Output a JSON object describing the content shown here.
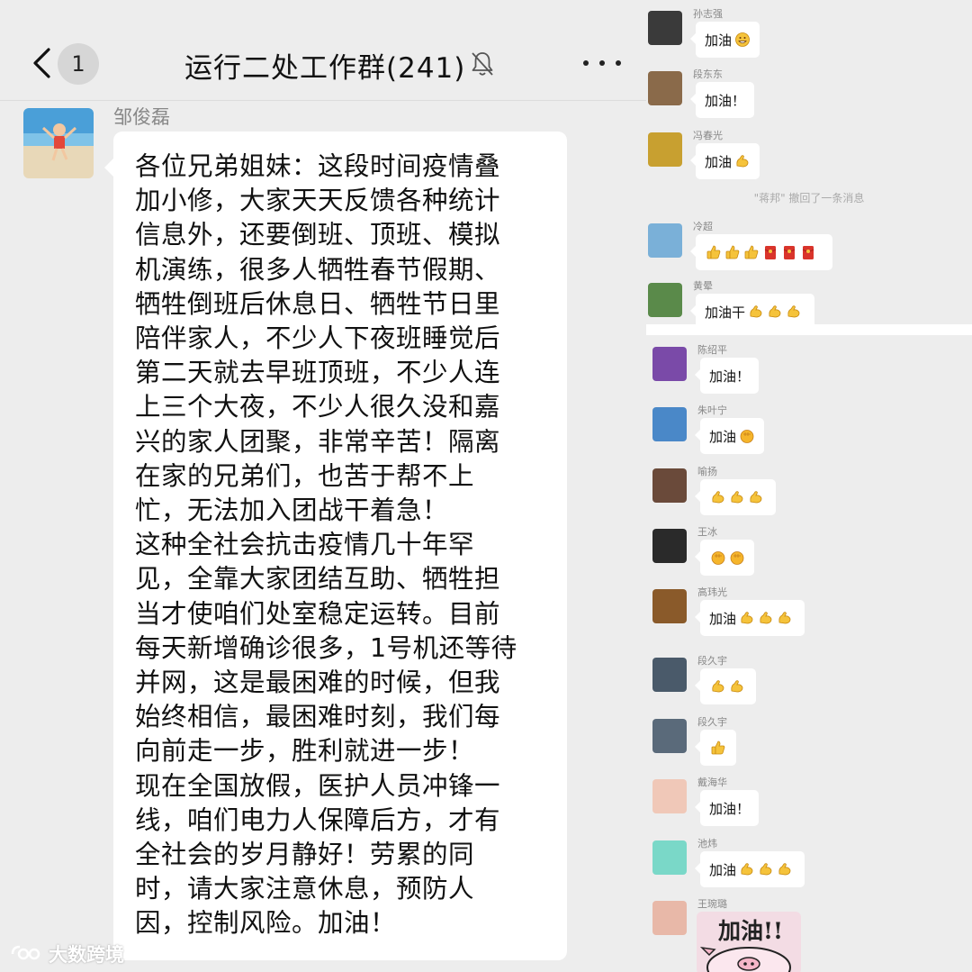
{
  "left": {
    "header": {
      "unread_count": "1",
      "title": "运行二处工作群(241)"
    },
    "message": {
      "sender": "邹俊磊",
      "text": "各位兄弟姐妹：这段时间疫情叠\n加小修，大家天天反馈各种统计\n信息外，还要倒班、顶班、模拟\n机演练，很多人牺牲春节假期、\n牺牲倒班后休息日、牺牲节日里\n陪伴家人，不少人下夜班睡觉后\n第二天就去早班顶班，不少人连\n上三个大夜，不少人很久没和嘉\n兴的家人团聚，非常辛苦！隔离\n在家的兄弟们，也苦于帮不上\n忙，无法加入团战干着急！\n这种全社会抗击疫情几十年罕\n见，全靠大家团结互助、牺牲担\n当才使咱们处室稳定运转。目前\n每天新增确诊很多，1号机还等待\n并网，这是最困难的时候，但我\n始终相信，最困难时刻，我们每\n向前走一步，胜利就进一步！\n现在全国放假，医护人员冲锋一\n线，咱们电力人保障后方，才有\n全社会的岁月静好！劳累的同\n时，请大家注意休息，预防人\n因，控制风险。加油！"
    },
    "watermark": "大数跨境"
  },
  "right": {
    "recall_note": "\"蒋邦\" 撤回了一条消息",
    "replies": [
      {
        "name": "孙志强",
        "text": "加油",
        "emojis": [
          "grin"
        ]
      },
      {
        "name": "段东东",
        "text": "加油！",
        "emojis": []
      },
      {
        "name": "冯春光",
        "text": "加油",
        "emojis": [
          "muscle"
        ]
      },
      {
        "name": "冷超",
        "text": "",
        "emojis": [
          "thumbs",
          "thumbs",
          "thumbs",
          "hongbao",
          "hongbao",
          "hongbao"
        ]
      },
      {
        "name": "黄晕",
        "text": "加油干",
        "emojis": [
          "muscle",
          "muscle",
          "muscle"
        ]
      },
      {
        "name": "陈绍平",
        "text": "加油！",
        "emojis": []
      },
      {
        "name": "朱叶宁",
        "text": "加油",
        "emojis": [
          "fist"
        ]
      },
      {
        "name": "喻扬",
        "text": "",
        "emojis": [
          "muscle",
          "muscle",
          "muscle"
        ]
      },
      {
        "name": "王冰",
        "text": "",
        "emojis": [
          "fist",
          "fist"
        ]
      },
      {
        "name": "高玮光",
        "text": "加油",
        "emojis": [
          "muscle",
          "muscle",
          "muscle"
        ]
      },
      {
        "name": "段久宇",
        "text": "",
        "emojis": [
          "muscle",
          "muscle"
        ]
      },
      {
        "name": "段久宇",
        "text": "",
        "emojis": [
          "thumbs"
        ]
      },
      {
        "name": "戴海华",
        "text": "加油！",
        "emojis": []
      },
      {
        "name": "池炜",
        "text": "加油",
        "emojis": [
          "muscle",
          "muscle",
          "muscle"
        ]
      },
      {
        "name": "王琬璐",
        "text": "",
        "emojis": []
      }
    ],
    "sticker_text": "加油!!"
  },
  "colors": {
    "background": "#ededed",
    "bubble": "#ffffff",
    "muscle_emoji": "#f5c33b",
    "hongbao_emoji": "#d9342b",
    "meta_text": "#888888"
  }
}
